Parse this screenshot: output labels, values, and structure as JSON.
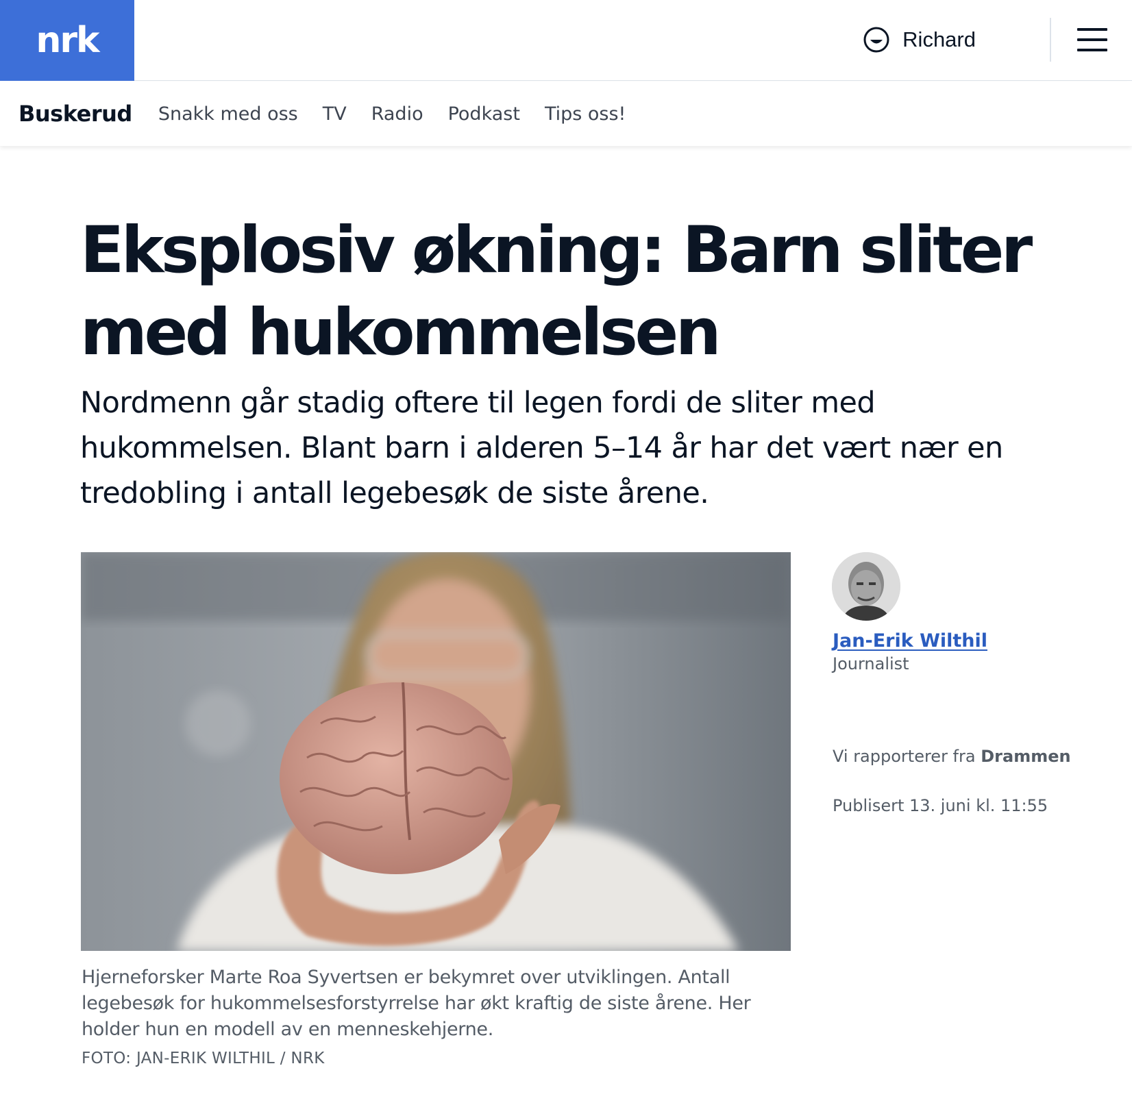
{
  "header": {
    "logo_text": "nrk",
    "user_name": "Richard",
    "brand_color": "#3d6fd8"
  },
  "subnav": {
    "region": "Buskerud",
    "links": [
      "Snakk med oss",
      "TV",
      "Radio",
      "Podkast",
      "Tips oss!"
    ]
  },
  "article": {
    "headline": "Eksplosiv økning: Barn sliter med hukommelsen",
    "lead": "Nordmenn går stadig oftere til legen fordi de sliter med hukommelsen. Blant barn i alderen 5–14 år har det vært nær en tredobling i antall legebesøk de siste årene.",
    "image_caption": "Hjerneforsker Marte Roa Syvertsen er bekymret over utviklingen. Antall legebesøk for hukommelsesforstyrrelse har økt kraftig de siste årene. Her holder hun en modell av en menneskehjerne.",
    "image_credit": "FOTO: JAN-ERIK WILTHIL / NRK"
  },
  "byline": {
    "author_name": "Jan-Erik Wilthil",
    "author_role": "Journalist",
    "location_prefix": "Vi rapporterer fra",
    "location": "Drammen",
    "published": "Publisert 13. juni kl. 11:55"
  },
  "icons": {
    "user": "user-face-icon",
    "menu": "hamburger-menu-icon"
  }
}
